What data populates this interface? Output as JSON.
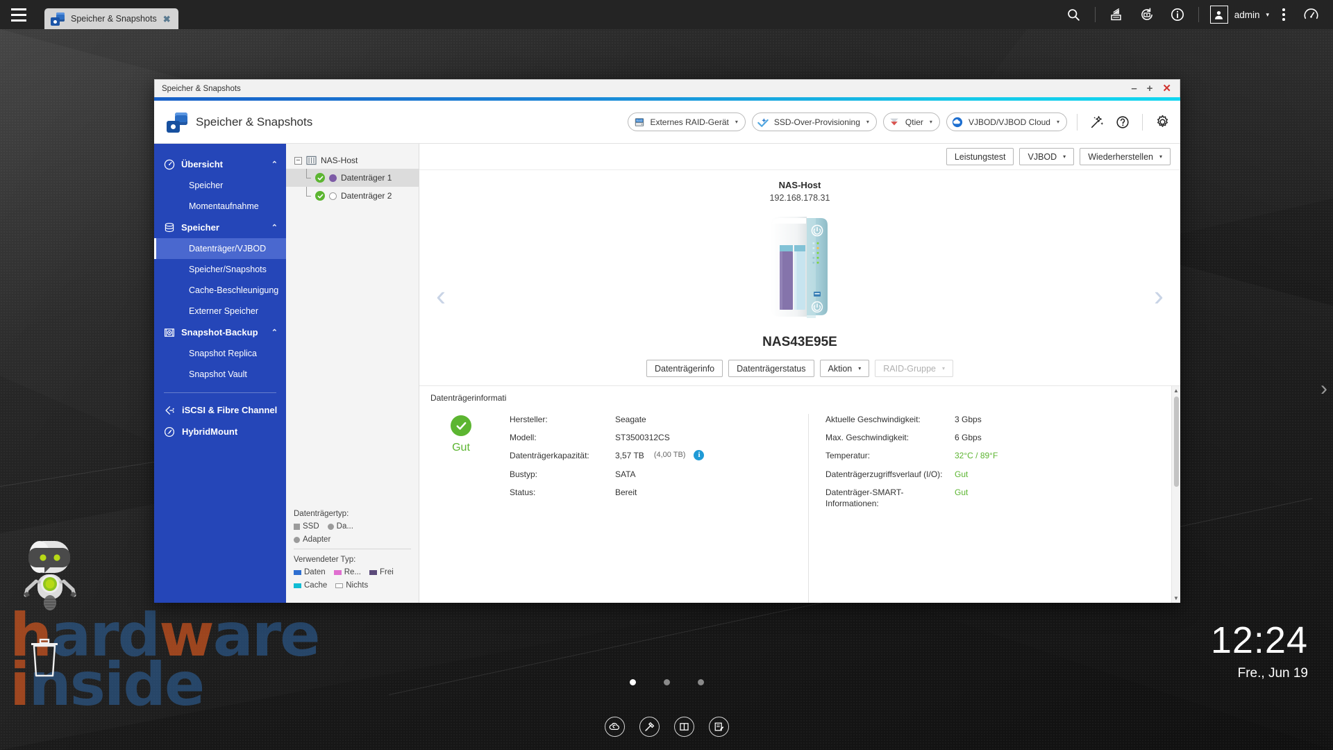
{
  "taskbar": {
    "menu_icon": "hamburger-menu-icon",
    "tab": {
      "label": "Speicher & Snapshots",
      "close": "✖",
      "icon": "storage-snapshots-icon"
    },
    "icons": [
      {
        "name": "search-icon",
        "label": "Suche"
      },
      {
        "name": "backgroundtask-icon",
        "label": "Hintergrundaufgaben"
      },
      {
        "name": "external-device-icon",
        "label": "Externe Geräte"
      },
      {
        "name": "info-icon",
        "label": "Informationen"
      }
    ],
    "user": {
      "name": "admin",
      "caret": "▾",
      "avatar": "user-avatar-icon"
    },
    "kebab": "more-options-icon",
    "dashboard": "dashboard-gauge-icon"
  },
  "desktop": {
    "watermark_line1_a": "h",
    "watermark_line1_b": "ard",
    "watermark_line1_c": "w",
    "watermark_line1_d": "are",
    "watermark_line2_a": "i",
    "watermark_line2_b": "nside",
    "trash_label": "trash-icon",
    "robot_label": "qboost-robot",
    "edge_next": "›",
    "page_dots": [
      {
        "active": true
      },
      {
        "active": false
      },
      {
        "active": false
      }
    ],
    "dock": [
      {
        "name": "cloud-icon",
        "glyph": "cloud"
      },
      {
        "name": "tools-icon",
        "glyph": "hammer"
      },
      {
        "name": "manual-icon",
        "glyph": "book"
      },
      {
        "name": "notes-icon",
        "glyph": "notepad"
      }
    ],
    "clock": {
      "time": "12:24",
      "date": "Fre., Jun 19"
    }
  },
  "window": {
    "title": "Speicher & Snapshots",
    "controls": {
      "minimize": "–",
      "maximize": "+",
      "close": "✕"
    }
  },
  "app": {
    "title": "Speicher & Snapshots",
    "header_buttons": [
      {
        "label": "Externes RAID-Gerät",
        "caret": "▾",
        "icon": "raid-device-icon"
      },
      {
        "label": "SSD-Over-Provisioning",
        "caret": "▾",
        "icon": "ssd-overprovision-icon"
      },
      {
        "label": "Qtier",
        "caret": "▾",
        "icon": "qtier-icon"
      },
      {
        "label": "VJBOD/VJBOD Cloud",
        "caret": "▾",
        "icon": "vjbod-cloud-icon"
      }
    ],
    "header_icons": [
      {
        "name": "wizard-wand-icon"
      },
      {
        "name": "help-question-icon"
      },
      {
        "name": "settings-gear-icon"
      }
    ]
  },
  "sidebar": {
    "groups": [
      {
        "label": "Übersicht",
        "icon": "overview-gauge-icon",
        "chevron": "⌃",
        "items": [
          {
            "label": "Speicher",
            "active": false
          },
          {
            "label": "Momentaufnahme",
            "active": false
          }
        ]
      },
      {
        "label": "Speicher",
        "icon": "storage-disks-icon",
        "chevron": "⌃",
        "items": [
          {
            "label": "Datenträger/VJBOD",
            "active": true
          },
          {
            "label": "Speicher/Snapshots",
            "active": false
          },
          {
            "label": "Cache-Beschleunigung",
            "active": false
          },
          {
            "label": "Externer Speicher",
            "active": false
          }
        ]
      },
      {
        "label": "Snapshot-Backup",
        "icon": "snapshot-backup-icon",
        "chevron": "⌃",
        "items": [
          {
            "label": "Snapshot Replica",
            "active": false
          },
          {
            "label": "Snapshot Vault",
            "active": false
          }
        ]
      }
    ],
    "flat_items": [
      {
        "label": "iSCSI & Fibre Channel",
        "icon": "iscsi-fc-icon"
      },
      {
        "label": "HybridMount",
        "icon": "hybridmount-icon"
      }
    ]
  },
  "tree": {
    "root": {
      "label": "NAS-Host",
      "toggle": "−",
      "icon": "nas-host-icon"
    },
    "children": [
      {
        "label": "Datenträger 1",
        "status": "ok",
        "type": "used",
        "selected": true
      },
      {
        "label": "Datenträger 2",
        "status": "ok",
        "type": "free",
        "selected": false
      }
    ]
  },
  "legend": {
    "disk_type_title": "Datenträgertyp:",
    "disk_types": [
      {
        "label": "SSD",
        "shape": "square",
        "color": "#9b9b9b"
      },
      {
        "label": "Da...",
        "shape": "circle",
        "color": "#9b9b9b"
      },
      {
        "label": "Adapter",
        "shape": "circle",
        "color": "#9b9b9b"
      }
    ],
    "used_type_title": "Verwendeter Typ:",
    "used_types": [
      {
        "label": "Daten",
        "color": "#2f6fd0"
      },
      {
        "label": "Re...",
        "color": "#e06fd0"
      },
      {
        "label": "Frei",
        "color": "#5b4a7a"
      },
      {
        "label": "Cache",
        "color": "#11bcd4"
      },
      {
        "label": "Nichts",
        "color": "#ffffff"
      }
    ]
  },
  "main": {
    "toolbar_buttons": [
      {
        "label": "Leistungstest",
        "caret": "",
        "disabled": false
      },
      {
        "label": "VJBOD",
        "caret": "▾",
        "disabled": false
      },
      {
        "label": "Wiederherstellen",
        "caret": "▾",
        "disabled": false
      }
    ],
    "host_name": "NAS-Host",
    "host_ip": "192.168.178.31",
    "arrow_prev": "‹",
    "arrow_next": "›",
    "model_name": "NAS43E95E",
    "disk_action_buttons": [
      {
        "label": "Datenträgerinfo",
        "caret": "",
        "disabled": false
      },
      {
        "label": "Datenträgerstatus",
        "caret": "",
        "disabled": false
      },
      {
        "label": "Aktion",
        "caret": "▾",
        "disabled": false
      },
      {
        "label": "RAID-Gruppe",
        "caret": "▾",
        "disabled": true
      }
    ],
    "info_section_label": "Datenträgerinformati",
    "health_status": "Gut",
    "info_left": [
      {
        "key": "Hersteller:",
        "value": "Seagate"
      },
      {
        "key": "Modell:",
        "value": "ST3500312CS"
      },
      {
        "key": "Datenträgerkapazität:",
        "value": "3,57 TB",
        "paren": "(4,00 TB)",
        "info_icon": "capacity-info-icon"
      },
      {
        "key": "Bustyp:",
        "value": "SATA"
      },
      {
        "key": "Status:",
        "value": "Bereit"
      }
    ],
    "info_right": [
      {
        "key": "Aktuelle Geschwindigkeit:",
        "value": "3 Gbps",
        "green": false
      },
      {
        "key": "Max. Geschwindigkeit:",
        "value": "6 Gbps",
        "green": false
      },
      {
        "key": "Temperatur:",
        "value": "32°C / 89°F",
        "green": true
      },
      {
        "key": "Datenträgerzugriffsverlauf (I/O):",
        "value": "Gut",
        "green": true
      },
      {
        "key": "Datenträger-SMART-Informationen:",
        "value": "Gut",
        "green": true
      }
    ]
  },
  "colors": {
    "accent_blue": "#2546b8",
    "active_item": "#4a68cf",
    "ok_green": "#5cb531",
    "info_blue": "#1f9ad6",
    "title_cyan": "#12d6f0"
  }
}
